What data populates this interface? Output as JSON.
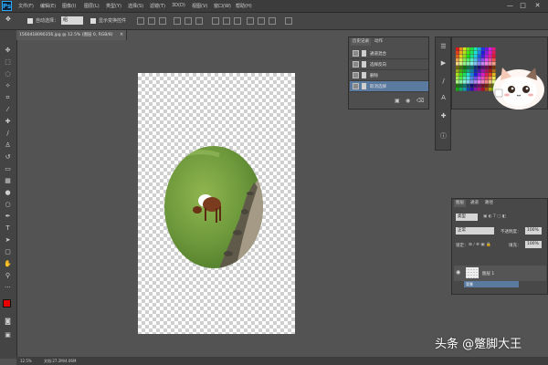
{
  "app": {
    "logo": "Ps"
  },
  "menu": [
    "文件(F)",
    "编辑(E)",
    "图像(I)",
    "图层(L)",
    "类型(Y)",
    "选择(S)",
    "滤镜(T)",
    "3D(D)",
    "视图(V)",
    "窗口(W)",
    "帮助(H)"
  ],
  "window_controls": {
    "minimize": "—",
    "maximize": "□",
    "close": "✕"
  },
  "options": {
    "auto_select_label": "自动选择：",
    "auto_select_value": "组",
    "show_transform_label": "显示变换控件"
  },
  "document": {
    "tab_title": "1560418090356.jpg @ 12.5% (图层 0, RGB/8)",
    "tab_close": "×"
  },
  "status": {
    "zoom": "12.5%",
    "doc_info": "文档:27.2M/4.06M"
  },
  "history_panel": {
    "tabs": [
      "历史记录",
      "动作"
    ],
    "items": [
      {
        "label": "通道混合"
      },
      {
        "label": "选择反向"
      },
      {
        "label": "删除"
      },
      {
        "label": "取消选择"
      }
    ]
  },
  "layers_panel": {
    "tabs": [
      "图层",
      "通道",
      "路径"
    ],
    "filter_kind": "类型",
    "blend_mode": "正常",
    "opacity_label": "不透明度：",
    "opacity_value": "100%",
    "lock_label": "锁定：",
    "fill_label": "填充：",
    "fill_value": "100%",
    "layer_name": "图层 1",
    "selected_row": "背景"
  },
  "colors": {
    "foreground": "#e60000",
    "background": "#ffffff",
    "selection": "#5b7aa0"
  },
  "watermark": "头条 @蹩脚大王"
}
